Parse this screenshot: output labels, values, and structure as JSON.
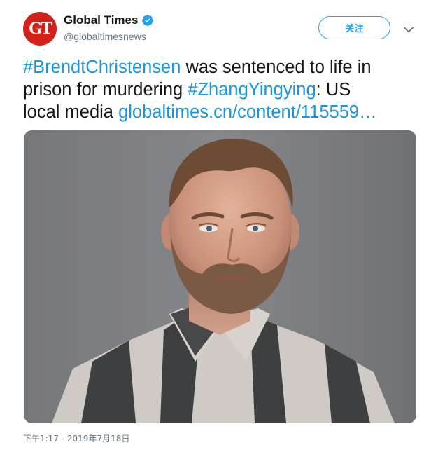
{
  "account": {
    "avatar_text": "GT",
    "display_name": "Global Times",
    "handle": "@globaltimesnews",
    "verified": true,
    "brand_color": "#d32219"
  },
  "follow_button": {
    "label": "关注"
  },
  "tweet": {
    "hashtag_1": "#BrendtChristensen",
    "text_1": " was sentenced to life in",
    "text_2": "prison for murdering ",
    "hashtag_2": "#ZhangYingying",
    "text_3": ": US",
    "text_4": "local media ",
    "link": "globaltimes.cn/content/115559…"
  },
  "media": {
    "type": "photo",
    "subject": "mugshot"
  },
  "timestamp": "下午1:17 - 2019年7月18日",
  "colors": {
    "accent": "#1da1f2",
    "link": "#1b95e0",
    "text": "#14171a",
    "muted": "#657786"
  },
  "icons": [
    "verified-badge-icon",
    "chevron-down-icon"
  ]
}
